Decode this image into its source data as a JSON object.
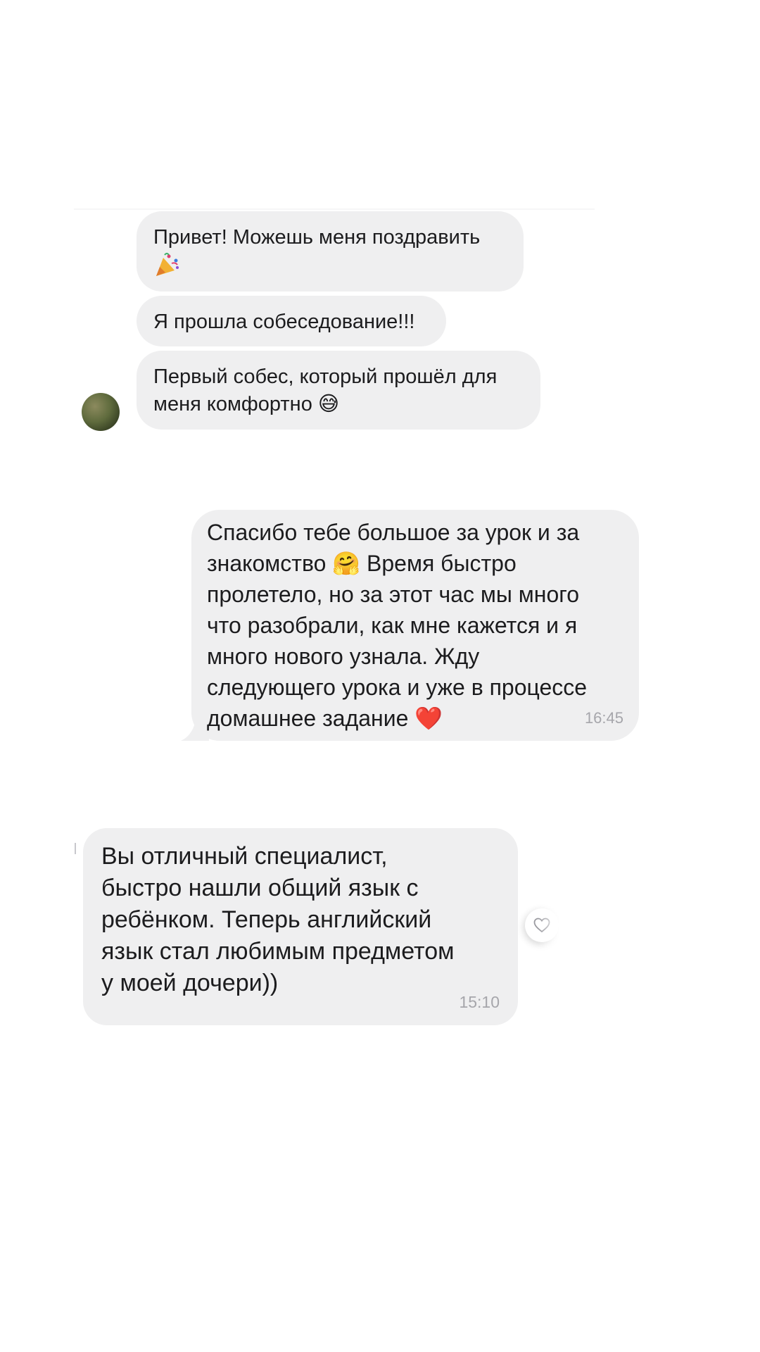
{
  "chat1": {
    "messages": [
      {
        "text": "Привет! Можешь меня поздравить",
        "emoji": "🎉"
      },
      {
        "text": "Я прошла собеседование!!!"
      },
      {
        "text_line1": "Первый собес, который прошёл для",
        "text_line2": "меня комфортно",
        "emoji": "😅"
      }
    ],
    "avatar_icon": "user-avatar-photo"
  },
  "chat2": {
    "lines": [
      "Спасибо тебе большое за урок и за",
      "знакомство",
      "Время быстро",
      "пролетело, но за этот час мы много",
      "что разобрали, как мне кажется и я",
      "много нового узнала. Жду",
      "следующего урока и уже в процессе",
      "домашнее задание"
    ],
    "emoji_hug": "🤗",
    "emoji_heart": "❤️",
    "time": "16:45"
  },
  "chat3": {
    "lines": [
      "Вы отличный специалист,",
      "быстро нашли общий язык с",
      "ребёнком. Теперь английский",
      "язык стал любимым предметом",
      "у моей дочери))"
    ],
    "time": "15:10",
    "like_icon": "heart-outline-icon"
  },
  "colors": {
    "bubble": "#efeff0",
    "time": "#a6a6ab",
    "heart_red": "#e0242b"
  }
}
